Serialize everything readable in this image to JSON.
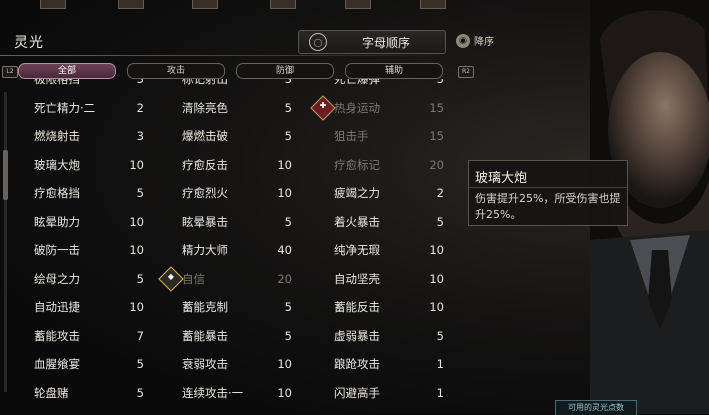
{
  "header": {
    "title": "灵光",
    "sort_label": "字母顺序",
    "sort_order_label": "降序",
    "left_key": "L2",
    "right_key": "R2"
  },
  "tabs": [
    {
      "label": "全部",
      "active": true
    },
    {
      "label": "攻击",
      "active": false
    },
    {
      "label": "防御",
      "active": false
    },
    {
      "label": "辅助",
      "active": false
    }
  ],
  "rows": [
    [
      {
        "name": "极限格挡",
        "value": "3"
      },
      {
        "name": "标记射出",
        "value": "3"
      },
      {
        "name": "死亡爆弹",
        "value": "5"
      }
    ],
    [
      {
        "name": "死亡精力·二",
        "value": "2"
      },
      {
        "name": "清除亮色",
        "value": "5"
      },
      {
        "name": "热身运动",
        "value": "15",
        "badge": "red",
        "dim": true,
        "highlight": true
      }
    ],
    [
      {
        "name": "燃烧射击",
        "value": "3"
      },
      {
        "name": "爆燃击破",
        "value": "5"
      },
      {
        "name": "狙击手",
        "value": "15",
        "dim": true
      }
    ],
    [
      {
        "name": "玻璃大炮",
        "value": "10",
        "highlight": true
      },
      {
        "name": "疗愈反击",
        "value": "10"
      },
      {
        "name": "疗愈标记",
        "value": "20",
        "dim": true
      }
    ],
    [
      {
        "name": "疗愈格挡",
        "value": "5"
      },
      {
        "name": "疗愈烈火",
        "value": "10"
      },
      {
        "name": "疲竭之力",
        "value": "2"
      }
    ],
    [
      {
        "name": "眩晕助力",
        "value": "10"
      },
      {
        "name": "眩晕暴击",
        "value": "5"
      },
      {
        "name": "着火暴击",
        "value": "5"
      }
    ],
    [
      {
        "name": "破防一击",
        "value": "10"
      },
      {
        "name": "精力大师",
        "value": "40",
        "highlight": true
      },
      {
        "name": "纯净无瑕",
        "value": "10",
        "highlight": true
      }
    ],
    [
      {
        "name": "绘母之力",
        "value": "5",
        "highlight": true
      },
      {
        "name": "自信",
        "value": "20",
        "badge": "gold",
        "dim": true
      },
      {
        "name": "自动坚壳",
        "value": "10"
      }
    ],
    [
      {
        "name": "自动迅捷",
        "value": "10"
      },
      {
        "name": "蓄能克制",
        "value": "5"
      },
      {
        "name": "蓄能反击",
        "value": "10"
      }
    ],
    [
      {
        "name": "蓄能攻击",
        "value": "7"
      },
      {
        "name": "蓄能暴击",
        "value": "5"
      },
      {
        "name": "虚弱暴击",
        "value": "5"
      }
    ],
    [
      {
        "name": "血腥飨宴",
        "value": "5"
      },
      {
        "name": "衰弱攻击",
        "value": "10"
      },
      {
        "name": "踉跄攻击",
        "value": "1"
      }
    ],
    [
      {
        "name": "轮盘赌",
        "value": "5"
      },
      {
        "name": "连续攻击·一",
        "value": "10"
      },
      {
        "name": "闪避高手",
        "value": "1"
      }
    ]
  ],
  "tooltip": {
    "title": "玻璃大炮",
    "description": "伤害提升25%，所受伤害也提升25%。"
  },
  "footer": {
    "hint": "可用的灵光点数"
  },
  "colors": {
    "highlight": "#5a3a4a",
    "accent": "#b58ea0"
  }
}
